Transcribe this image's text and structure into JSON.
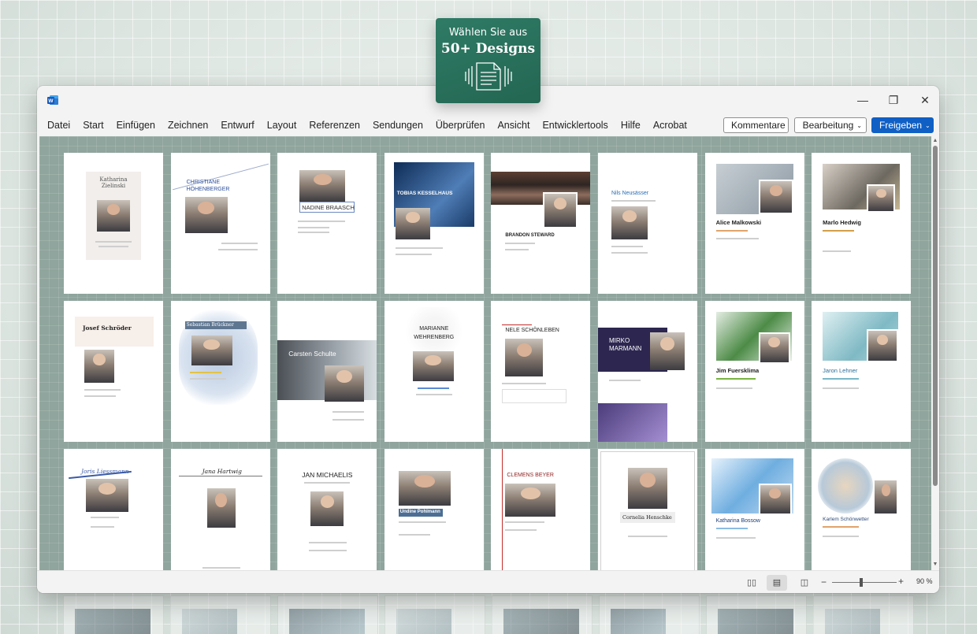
{
  "badge": {
    "subtitle": "Wählen Sie aus",
    "title": "50+ Designs"
  },
  "window": {
    "controls": {
      "minimize": "—",
      "restore": "❐",
      "close": "✕"
    }
  },
  "menu": [
    "Datei",
    "Start",
    "Einfügen",
    "Zeichnen",
    "Entwurf",
    "Layout",
    "Referenzen",
    "Sendungen",
    "Überprüfen",
    "Ansicht",
    "Entwicklertools",
    "Hilfe",
    "Acrobat"
  ],
  "toolbar": {
    "comments_label": "Kommentare",
    "editing_label": "Bearbeitung",
    "share_label": "Freigeben"
  },
  "templates": [
    {
      "name": "Katharina Zielinski"
    },
    {
      "name": "CHRISTIANE HÖHENBERGER"
    },
    {
      "name": "NADINE BRAASCH"
    },
    {
      "name": "TOBIAS KESSELHAUS"
    },
    {
      "name": "BRANDON STEWARD"
    },
    {
      "name": "Nils Neusässer"
    },
    {
      "name": "Alice Malkowski"
    },
    {
      "name": "Marlo Hedwig"
    },
    {
      "name": "Josef Schröder"
    },
    {
      "name": "Sebastian Brückner"
    },
    {
      "name": "Carsten Schulte"
    },
    {
      "name": "MARIANNE WEHRENBERG"
    },
    {
      "name": "NELE SCHÖNLEBEN"
    },
    {
      "name": "MIRKO MARMANN"
    },
    {
      "name": "Jim Fuersklima"
    },
    {
      "name": "Jaron Lehner"
    },
    {
      "name": "Joris Liessmann"
    },
    {
      "name": "Jana Hartwig"
    },
    {
      "name": "JAN MICHAELIS"
    },
    {
      "name": "Undine Pohlmann"
    },
    {
      "name": "CLEMENS BEYER"
    },
    {
      "name": "Cornelia Henschke"
    },
    {
      "name": "Katharina Bossow"
    },
    {
      "name": "Karlem Schönwetter"
    }
  ],
  "statusbar": {
    "zoom": "90 %",
    "zoom_minus": "−",
    "zoom_plus": "+"
  },
  "colors": {
    "accent_green": "#2f7b65",
    "share_blue": "#0f5fc5",
    "word_blue": "#185abd"
  },
  "icons": [
    "word-logo-icon",
    "comment-icon",
    "pencil-icon",
    "share-icon",
    "read-mode-icon",
    "print-layout-icon",
    "web-layout-icon",
    "document-icon"
  ]
}
